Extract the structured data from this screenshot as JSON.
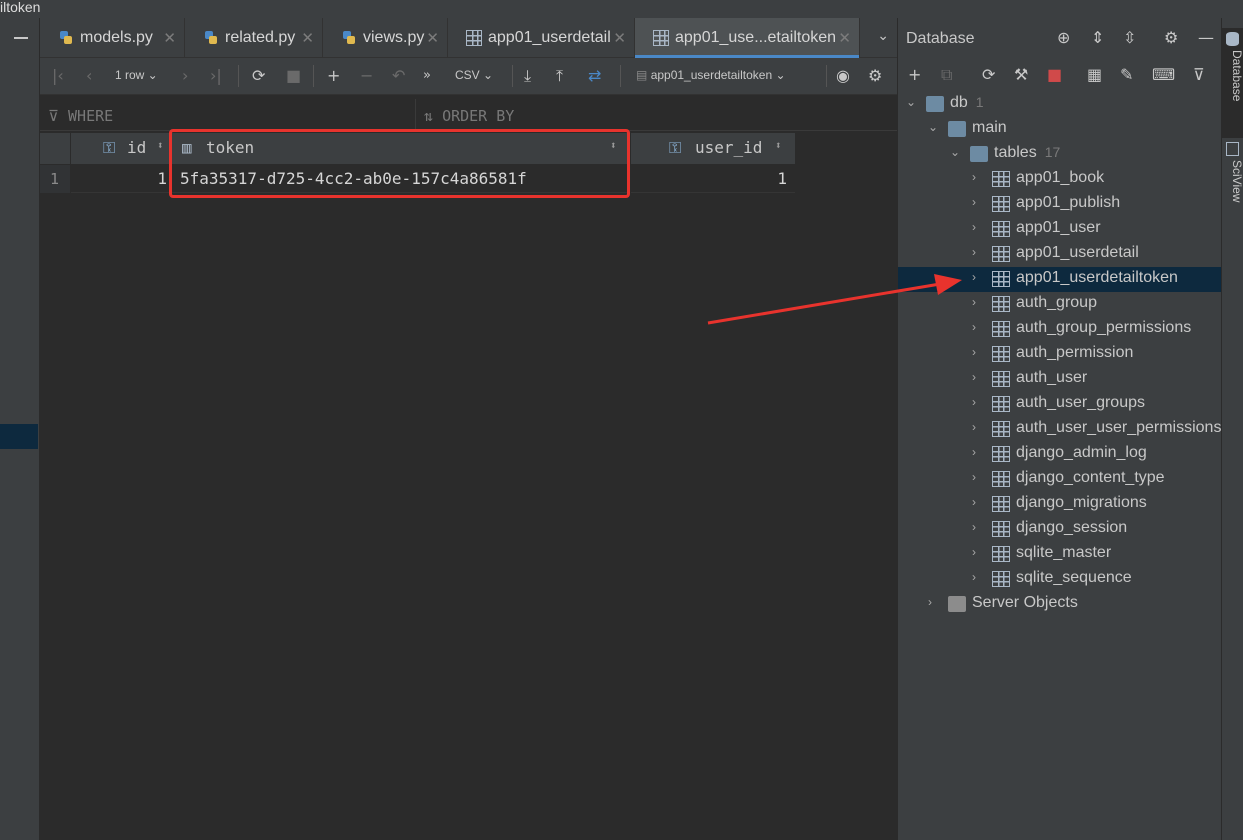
{
  "window": {
    "title_fragment": "iltoken"
  },
  "tabs": [
    {
      "label": "models.py",
      "icon": "python-file-icon"
    },
    {
      "label": "related.py",
      "icon": "python-file-icon"
    },
    {
      "label": "views.py",
      "icon": "python-file-icon"
    },
    {
      "label": "app01_userdetail",
      "icon": "table-icon"
    },
    {
      "label": "app01_use...etailtoken",
      "icon": "table-icon",
      "active": true
    }
  ],
  "toolbar": {
    "row_count": "1 row",
    "export_format": "CSV",
    "datasource": "app01_userdetailtoken"
  },
  "filter": {
    "where": "WHERE",
    "order_by": "ORDER BY"
  },
  "grid": {
    "columns": [
      {
        "label": "id",
        "icon": "primary-key-icon"
      },
      {
        "label": "token",
        "icon": "column-icon"
      },
      {
        "label": "user_id",
        "icon": "foreign-key-icon"
      }
    ],
    "rows": [
      {
        "num": "1",
        "id": "1",
        "token": "5fa35317-d725-4cc2-ab0e-157c4a86581f",
        "user_id": "1"
      }
    ]
  },
  "db_panel": {
    "title": "Database",
    "tree": {
      "db": {
        "label": "db",
        "count": "1"
      },
      "schema": {
        "label": "main"
      },
      "tables_folder": {
        "label": "tables",
        "count": "17"
      },
      "tables": [
        "app01_book",
        "app01_publish",
        "app01_user",
        "app01_userdetail",
        "app01_userdetailtoken",
        "auth_group",
        "auth_group_permissions",
        "auth_permission",
        "auth_user",
        "auth_user_groups",
        "auth_user_user_permissions",
        "django_admin_log",
        "django_content_type",
        "django_migrations",
        "django_session",
        "sqlite_master",
        "sqlite_sequence"
      ],
      "selected_table": "app01_userdetailtoken",
      "server_objects": {
        "label": "Server Objects"
      }
    }
  },
  "side_tabs": {
    "database": "Database",
    "sciview": "SciView"
  },
  "colors": {
    "annotation_red": "#e8332d",
    "accent_blue": "#4a88c7",
    "selection": "#0d293e"
  }
}
